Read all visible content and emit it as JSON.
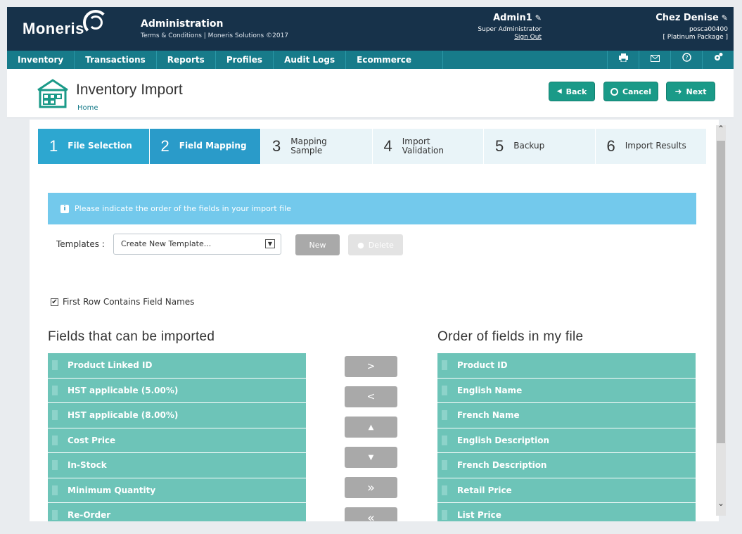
{
  "header": {
    "logo": "Moneris",
    "title": "Administration",
    "subtitle": "Terms & Conditions | Moneris Solutions ©2017",
    "user_name": "Admin1",
    "user_role": "Super Administrator",
    "sign_out": "Sign Out",
    "store_name": "Chez Denise",
    "store_id": "posca00400",
    "store_package": "[ Platinum Package ]"
  },
  "nav": {
    "items": [
      "Inventory",
      "Transactions",
      "Reports",
      "Profiles",
      "Audit Logs",
      "Ecommerce"
    ],
    "icons": [
      "printer-icon",
      "mail-icon",
      "help-icon",
      "settings-icon"
    ]
  },
  "page": {
    "title": "Inventory Import",
    "breadcrumb": "Home",
    "back_label": "Back",
    "cancel_label": "Cancel",
    "next_label": "Next"
  },
  "steps": [
    {
      "num": "1",
      "label": "File Selection",
      "state": "done"
    },
    {
      "num": "2",
      "label": "Field Mapping",
      "state": "active"
    },
    {
      "num": "3",
      "label": "Mapping Sample",
      "state": "pending"
    },
    {
      "num": "4",
      "label": "Import Validation",
      "state": "pending"
    },
    {
      "num": "5",
      "label": "Backup",
      "state": "pending"
    },
    {
      "num": "6",
      "label": "Import Results",
      "state": "pending"
    }
  ],
  "info": {
    "icon_letter": "i",
    "message": "Please indicate the order of the fields in your import file"
  },
  "templates": {
    "label": "Templates :",
    "selected": "Create New Template...",
    "new_label": "New",
    "delete_label": "Delete"
  },
  "first_row": {
    "label": "First Row Contains Field Names",
    "checked": true
  },
  "available": {
    "title": "Fields that can be imported",
    "items": [
      "Product Linked ID",
      "HST applicable (5.00%)",
      "HST applicable (8.00%)",
      "Cost Price",
      "In-Stock",
      "Minimum Quantity",
      "Re-Order"
    ]
  },
  "ordered": {
    "title": "Order of fields in my file",
    "items": [
      "Product ID",
      "English Name",
      "French Name",
      "English Description",
      "French Description",
      "Retail Price",
      "List Price"
    ]
  },
  "arrows": [
    {
      "name": "move-right",
      "glyph": ">"
    },
    {
      "name": "move-left",
      "glyph": "<"
    },
    {
      "name": "move-up",
      "glyph": "▲"
    },
    {
      "name": "move-down",
      "glyph": "▼"
    },
    {
      "name": "move-all-right",
      "glyph": "»"
    },
    {
      "name": "move-all-left",
      "glyph": "«"
    }
  ],
  "colors": {
    "header_bg": "#17324a",
    "nav_bg": "#177b8a",
    "accent_button": "#1a9a88",
    "step_active": "#2a9bc9",
    "info_bg": "#73c9ec",
    "list_row": "#6dc4b8"
  }
}
